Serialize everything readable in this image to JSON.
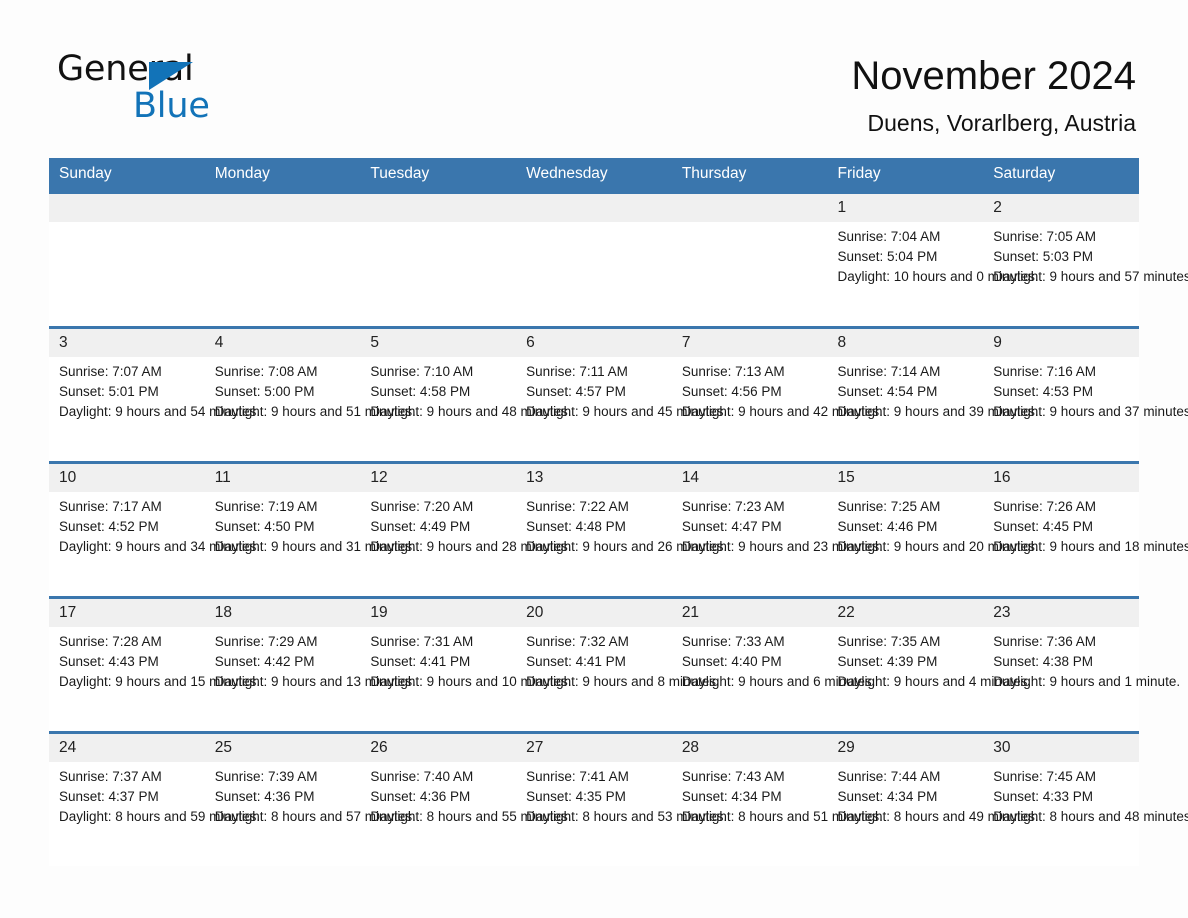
{
  "brand": {
    "name_primary": "General",
    "name_secondary": "Blue"
  },
  "header": {
    "title": "November 2024",
    "location": "Duens, Vorarlberg, Austria"
  },
  "colors": {
    "header_blue": "#3a76ad",
    "logo_blue": "#1273b8",
    "daynum_background": "#f0f0f0",
    "page_background": "#fdfdfd"
  },
  "weekday_headers": [
    "Sunday",
    "Monday",
    "Tuesday",
    "Wednesday",
    "Thursday",
    "Friday",
    "Saturday"
  ],
  "weeks": [
    [
      {
        "day": "",
        "sunrise": "",
        "sunset": "",
        "daylight": ""
      },
      {
        "day": "",
        "sunrise": "",
        "sunset": "",
        "daylight": ""
      },
      {
        "day": "",
        "sunrise": "",
        "sunset": "",
        "daylight": ""
      },
      {
        "day": "",
        "sunrise": "",
        "sunset": "",
        "daylight": ""
      },
      {
        "day": "",
        "sunrise": "",
        "sunset": "",
        "daylight": ""
      },
      {
        "day": "1",
        "sunrise": "Sunrise: 7:04 AM",
        "sunset": "Sunset: 5:04 PM",
        "daylight": "Daylight: 10 hours and 0 minutes."
      },
      {
        "day": "2",
        "sunrise": "Sunrise: 7:05 AM",
        "sunset": "Sunset: 5:03 PM",
        "daylight": "Daylight: 9 hours and 57 minutes."
      }
    ],
    [
      {
        "day": "3",
        "sunrise": "Sunrise: 7:07 AM",
        "sunset": "Sunset: 5:01 PM",
        "daylight": "Daylight: 9 hours and 54 minutes."
      },
      {
        "day": "4",
        "sunrise": "Sunrise: 7:08 AM",
        "sunset": "Sunset: 5:00 PM",
        "daylight": "Daylight: 9 hours and 51 minutes."
      },
      {
        "day": "5",
        "sunrise": "Sunrise: 7:10 AM",
        "sunset": "Sunset: 4:58 PM",
        "daylight": "Daylight: 9 hours and 48 minutes."
      },
      {
        "day": "6",
        "sunrise": "Sunrise: 7:11 AM",
        "sunset": "Sunset: 4:57 PM",
        "daylight": "Daylight: 9 hours and 45 minutes."
      },
      {
        "day": "7",
        "sunrise": "Sunrise: 7:13 AM",
        "sunset": "Sunset: 4:56 PM",
        "daylight": "Daylight: 9 hours and 42 minutes."
      },
      {
        "day": "8",
        "sunrise": "Sunrise: 7:14 AM",
        "sunset": "Sunset: 4:54 PM",
        "daylight": "Daylight: 9 hours and 39 minutes."
      },
      {
        "day": "9",
        "sunrise": "Sunrise: 7:16 AM",
        "sunset": "Sunset: 4:53 PM",
        "daylight": "Daylight: 9 hours and 37 minutes."
      }
    ],
    [
      {
        "day": "10",
        "sunrise": "Sunrise: 7:17 AM",
        "sunset": "Sunset: 4:52 PM",
        "daylight": "Daylight: 9 hours and 34 minutes."
      },
      {
        "day": "11",
        "sunrise": "Sunrise: 7:19 AM",
        "sunset": "Sunset: 4:50 PM",
        "daylight": "Daylight: 9 hours and 31 minutes."
      },
      {
        "day": "12",
        "sunrise": "Sunrise: 7:20 AM",
        "sunset": "Sunset: 4:49 PM",
        "daylight": "Daylight: 9 hours and 28 minutes."
      },
      {
        "day": "13",
        "sunrise": "Sunrise: 7:22 AM",
        "sunset": "Sunset: 4:48 PM",
        "daylight": "Daylight: 9 hours and 26 minutes."
      },
      {
        "day": "14",
        "sunrise": "Sunrise: 7:23 AM",
        "sunset": "Sunset: 4:47 PM",
        "daylight": "Daylight: 9 hours and 23 minutes."
      },
      {
        "day": "15",
        "sunrise": "Sunrise: 7:25 AM",
        "sunset": "Sunset: 4:46 PM",
        "daylight": "Daylight: 9 hours and 20 minutes."
      },
      {
        "day": "16",
        "sunrise": "Sunrise: 7:26 AM",
        "sunset": "Sunset: 4:45 PM",
        "daylight": "Daylight: 9 hours and 18 minutes."
      }
    ],
    [
      {
        "day": "17",
        "sunrise": "Sunrise: 7:28 AM",
        "sunset": "Sunset: 4:43 PM",
        "daylight": "Daylight: 9 hours and 15 minutes."
      },
      {
        "day": "18",
        "sunrise": "Sunrise: 7:29 AM",
        "sunset": "Sunset: 4:42 PM",
        "daylight": "Daylight: 9 hours and 13 minutes."
      },
      {
        "day": "19",
        "sunrise": "Sunrise: 7:31 AM",
        "sunset": "Sunset: 4:41 PM",
        "daylight": "Daylight: 9 hours and 10 minutes."
      },
      {
        "day": "20",
        "sunrise": "Sunrise: 7:32 AM",
        "sunset": "Sunset: 4:41 PM",
        "daylight": "Daylight: 9 hours and 8 minutes."
      },
      {
        "day": "21",
        "sunrise": "Sunrise: 7:33 AM",
        "sunset": "Sunset: 4:40 PM",
        "daylight": "Daylight: 9 hours and 6 minutes."
      },
      {
        "day": "22",
        "sunrise": "Sunrise: 7:35 AM",
        "sunset": "Sunset: 4:39 PM",
        "daylight": "Daylight: 9 hours and 4 minutes."
      },
      {
        "day": "23",
        "sunrise": "Sunrise: 7:36 AM",
        "sunset": "Sunset: 4:38 PM",
        "daylight": "Daylight: 9 hours and 1 minute."
      }
    ],
    [
      {
        "day": "24",
        "sunrise": "Sunrise: 7:37 AM",
        "sunset": "Sunset: 4:37 PM",
        "daylight": "Daylight: 8 hours and 59 minutes."
      },
      {
        "day": "25",
        "sunrise": "Sunrise: 7:39 AM",
        "sunset": "Sunset: 4:36 PM",
        "daylight": "Daylight: 8 hours and 57 minutes."
      },
      {
        "day": "26",
        "sunrise": "Sunrise: 7:40 AM",
        "sunset": "Sunset: 4:36 PM",
        "daylight": "Daylight: 8 hours and 55 minutes."
      },
      {
        "day": "27",
        "sunrise": "Sunrise: 7:41 AM",
        "sunset": "Sunset: 4:35 PM",
        "daylight": "Daylight: 8 hours and 53 minutes."
      },
      {
        "day": "28",
        "sunrise": "Sunrise: 7:43 AM",
        "sunset": "Sunset: 4:34 PM",
        "daylight": "Daylight: 8 hours and 51 minutes."
      },
      {
        "day": "29",
        "sunrise": "Sunrise: 7:44 AM",
        "sunset": "Sunset: 4:34 PM",
        "daylight": "Daylight: 8 hours and 49 minutes."
      },
      {
        "day": "30",
        "sunrise": "Sunrise: 7:45 AM",
        "sunset": "Sunset: 4:33 PM",
        "daylight": "Daylight: 8 hours and 48 minutes."
      }
    ]
  ]
}
